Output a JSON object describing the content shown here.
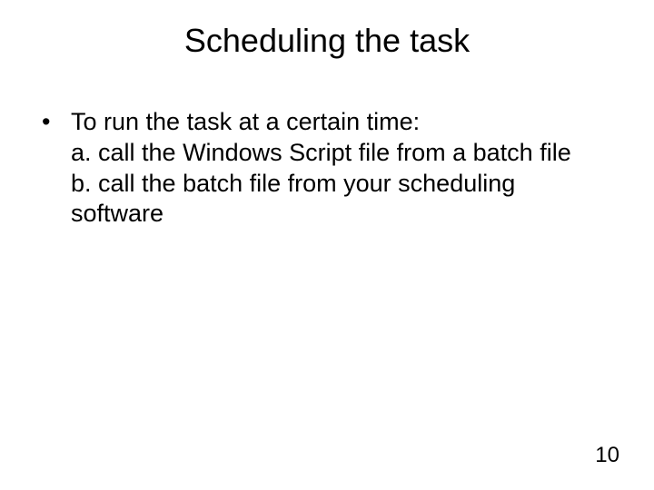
{
  "title": "Scheduling the task",
  "bullet": {
    "symbol": "•",
    "lead": "To run the task at a certain time:",
    "sub_a": "a. call the Windows Script file from a batch file",
    "sub_b": "b. call the batch file from your scheduling software"
  },
  "page_number": "10"
}
